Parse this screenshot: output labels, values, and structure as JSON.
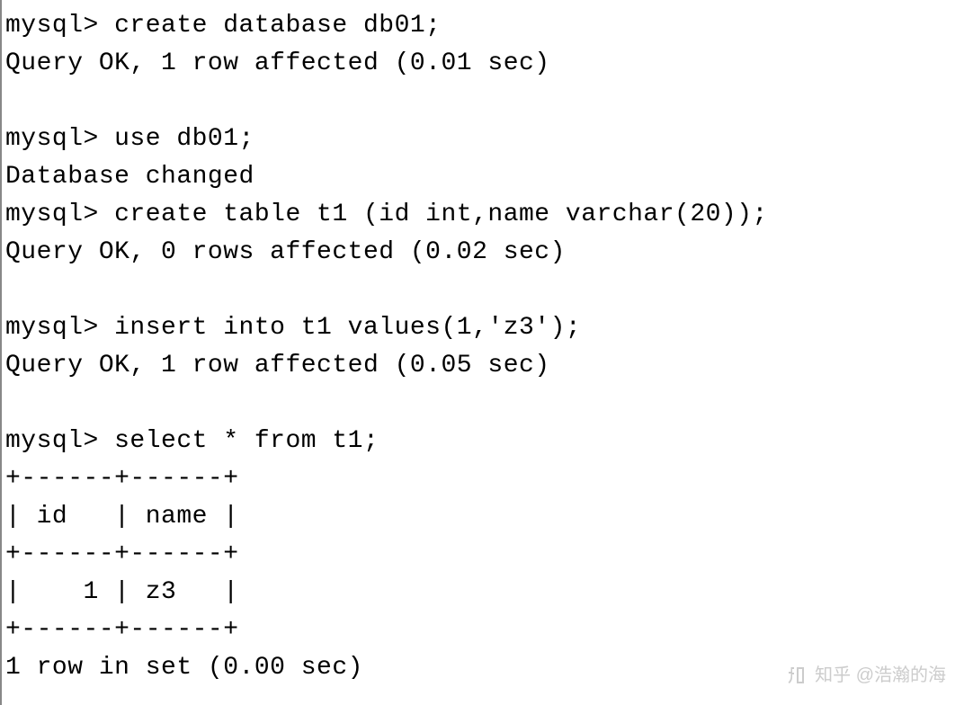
{
  "prompt": "mysql>",
  "session": [
    {
      "input": "create database db01;",
      "output": [
        "Query OK, 1 row affected (0.01 sec)"
      ]
    },
    {
      "input": "use db01;",
      "output": [
        "Database changed"
      ]
    },
    {
      "input": "create table t1 (id int,name varchar(20));",
      "output": [
        "Query OK, 0 rows affected (0.02 sec)"
      ]
    },
    {
      "input": "insert into t1 values(1,'z3');",
      "output": [
        "Query OK, 1 row affected (0.05 sec)"
      ]
    },
    {
      "input": "select * from t1;",
      "output": [
        "+------+------+",
        "| id   | name |",
        "+------+------+",
        "|    1 | z3   |",
        "+------+------+",
        "1 row in set (0.00 sec)"
      ]
    }
  ],
  "lines": {
    "l1": "mysql> create database db01;",
    "l2": "Query OK, 1 row affected (0.01 sec)",
    "l3": "mysql> use db01;",
    "l4": "Database changed",
    "l5": "mysql> create table t1 (id int,name varchar(20));",
    "l6": "Query OK, 0 rows affected (0.02 sec)",
    "l7": "mysql> insert into t1 values(1,'z3');",
    "l8": "Query OK, 1 row affected (0.05 sec)",
    "l9": "mysql> select * from t1;",
    "l10": "+------+------+",
    "l11": "| id   | name |",
    "l12": "+------+------+",
    "l13": "|    1 | z3   |",
    "l14": "+------+------+",
    "l15": "1 row in set (0.00 sec)"
  },
  "table_result": {
    "columns": [
      "id",
      "name"
    ],
    "rows": [
      {
        "id": 1,
        "name": "z3"
      }
    ]
  },
  "watermark": "知乎 @浩瀚的海"
}
